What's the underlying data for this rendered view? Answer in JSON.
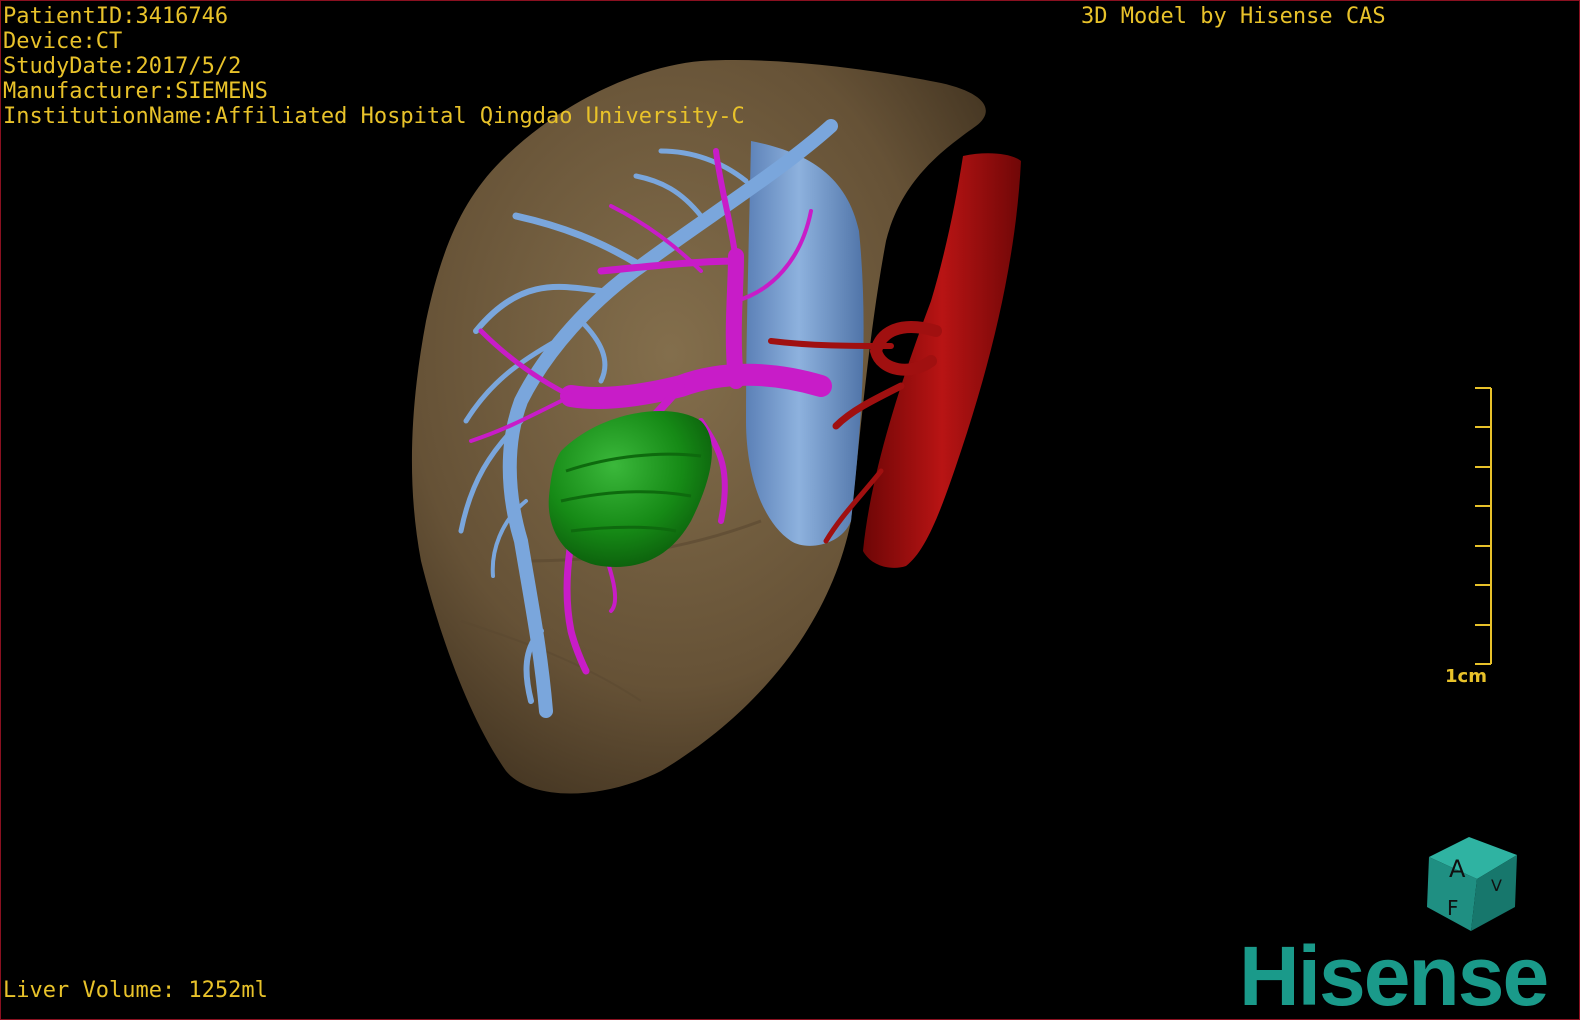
{
  "viewer": {
    "patient_id": "PatientID:3416746",
    "device": "Device:CT",
    "study_date": "StudyDate:2017/5/2",
    "manufacturer": "Manufacturer:SIEMENS",
    "institution": "InstitutionName:Affiliated Hospital Qingdao University-C",
    "model_credit": "3D Model by Hisense CAS",
    "liver_volume": "Liver Volume: 1252ml",
    "scale_label": "1cm",
    "brand": "Hisense"
  },
  "orientation_cube": {
    "face_top": "A",
    "face_left": "F",
    "face_right": "V"
  },
  "colors": {
    "overlay_text": "#e8c22a",
    "liver": "#6e5a3e",
    "hepatic_vein": "#7aa6dc",
    "portal_vein": "#c81cc8",
    "lesion": "#1a8c1a",
    "aorta": "#a01010",
    "brand": "#1a9a8a"
  }
}
